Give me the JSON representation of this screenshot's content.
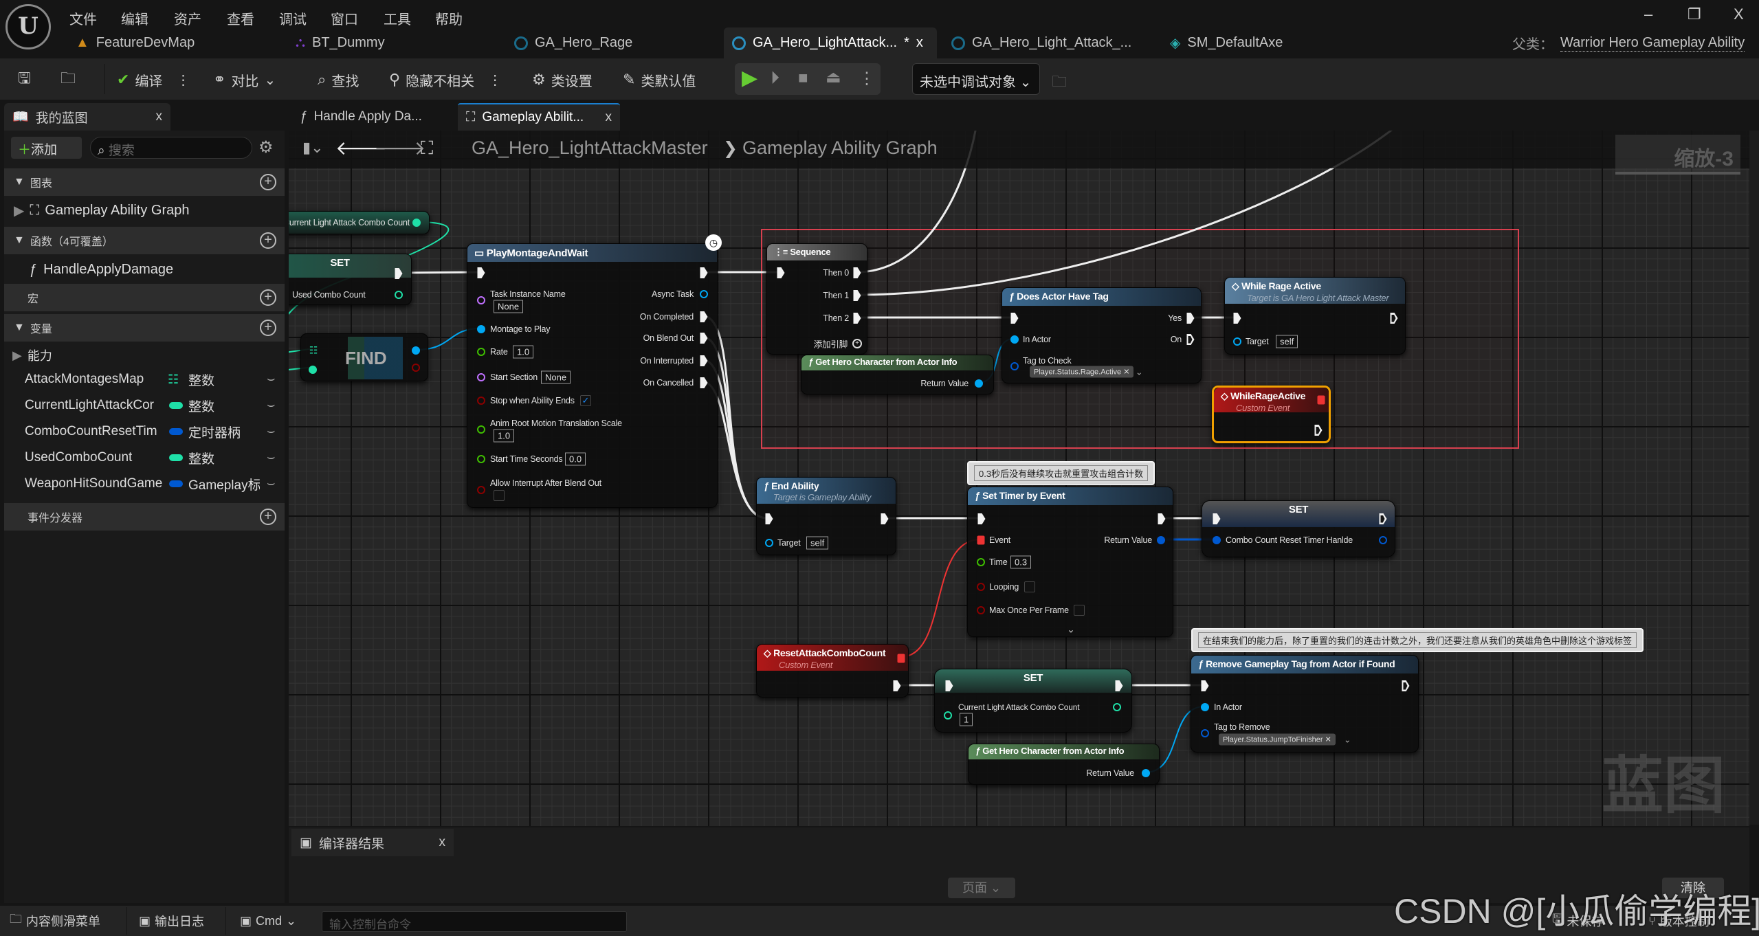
{
  "menu": [
    "文件",
    "编辑",
    "资产",
    "查看",
    "调试",
    "窗口",
    "工具",
    "帮助"
  ],
  "window_controls": {
    "minimize": "–",
    "restore": "❐",
    "close": "X"
  },
  "asset_tabs": [
    {
      "label": "FeatureDevMap",
      "icon": "level-icon"
    },
    {
      "label": "BT_Dummy",
      "icon": "behavior-tree-icon"
    },
    {
      "label": "GA_Hero_Rage",
      "icon": "blueprint-icon"
    },
    {
      "label": "GA_Hero_LightAttack...",
      "icon": "blueprint-icon",
      "active": true,
      "dirty": "*",
      "close": "x"
    },
    {
      "label": "GA_Hero_Light_Attack_...",
      "icon": "blueprint-icon"
    },
    {
      "label": "SM_DefaultAxe",
      "icon": "static-mesh-icon"
    }
  ],
  "parent_class": {
    "label": "父类：",
    "value": "Warrior Hero Gameplay Ability"
  },
  "toolbar": {
    "compile": "编译",
    "diff": "对比",
    "find": "查找",
    "hide_unrelated": "隐藏不相关",
    "class_settings": "类设置",
    "class_defaults": "类默认值",
    "debug_object": "未选中调试对象"
  },
  "my_blueprint": {
    "tab": "我的蓝图",
    "close": "x",
    "add": "添加",
    "search_placeholder": "搜索",
    "sections": {
      "graphs": "图表",
      "functions": "函数（4可覆盖）",
      "macros": "宏",
      "variables": "变量",
      "dispatchers": "事件分发器"
    },
    "graph_item": "Gameplay Ability Graph",
    "function_item": "HandleApplyDamage",
    "category": "能力",
    "variables": [
      {
        "name": "AttackMontagesMap",
        "type": "整数",
        "color": "#1fe0a8"
      },
      {
        "name": "CurrentLightAttackCor",
        "type": "整数",
        "color": "#1fe0a8"
      },
      {
        "name": "ComboCountResetTim",
        "type": "定时器柄",
        "color": "#0059d1"
      },
      {
        "name": "UsedComboCount",
        "type": "整数",
        "color": "#1fe0a8"
      },
      {
        "name": "WeaponHitSoundGame",
        "type": "Gameplay标",
        "color": "#0059d1"
      }
    ]
  },
  "graph_tabs": [
    {
      "label": "Handle Apply Da..."
    },
    {
      "label": "Gameplay Abilit...",
      "active": true,
      "close": "x"
    }
  ],
  "breadcrumb": {
    "blueprint": "GA_Hero_LightAttackMaster",
    "separator": "❯",
    "graph": "Gameplay Ability Graph"
  },
  "zoom_label": "缩放-3",
  "watermark": "蓝图",
  "nodes": {
    "getter": {
      "label": "Current Light Attack Combo Count"
    },
    "set_used": {
      "title": "SET",
      "pin": "Used Combo Count"
    },
    "find": {
      "title": "FIND"
    },
    "play_montage": {
      "title": "PlayMontageAndWait",
      "task_instance_name": "Task Instance Name",
      "task_instance_value": "None",
      "montage": "Montage to Play",
      "rate": "Rate",
      "rate_value": "1.0",
      "start_section": "Start Section",
      "start_section_value": "None",
      "stop_when_ends": "Stop when Ability Ends",
      "stop_when_ends_checked": true,
      "anim_root": "Anim Root Motion Translation Scale",
      "anim_root_value": "1.0",
      "start_time": "Start Time Seconds",
      "start_time_value": "0.0",
      "allow_interrupt": "Allow Interrupt After Blend Out",
      "allow_interrupt_checked": false,
      "async_task": "Async Task",
      "on_completed": "On Completed",
      "on_blend_out": "On Blend Out",
      "on_interrupted": "On Interrupted",
      "on_cancelled": "On Cancelled"
    },
    "sequence": {
      "title": "Sequence",
      "then0": "Then 0",
      "then1": "Then 1",
      "then2": "Then 2",
      "add_pin": "添加引脚"
    },
    "get_hero_1": {
      "title": "Get Hero Character from Actor Info",
      "return": "Return Value"
    },
    "does_actor_have_tag": {
      "title": "Does Actor Have Tag",
      "in_actor": "In Actor",
      "tag_to_check": "Tag to Check",
      "tag": "Player.Status.Rage.Active",
      "yes": "Yes",
      "no": "On"
    },
    "while_rage_active": {
      "title": "While Rage Active",
      "subtitle": "Target is GA Hero Light Attack Master",
      "target": "Target",
      "target_value": "self"
    },
    "while_rage_event": {
      "title": "WhileRageActive",
      "subtitle": "Custom Event"
    },
    "end_ability": {
      "title": "End Ability",
      "subtitle": "Target is Gameplay Ability",
      "target": "Target",
      "target_value": "self"
    },
    "set_timer": {
      "title": "Set Timer by Event",
      "event": "Event",
      "time": "Time",
      "time_value": "0.3",
      "looping": "Looping",
      "max_once": "Max Once Per Frame",
      "return": "Return Value"
    },
    "set_timer_handle": {
      "title": "SET",
      "pin": "Combo Count Reset Timer Hanlde"
    },
    "reset_event": {
      "title": "ResetAttackComboCount",
      "subtitle": "Custom Event"
    },
    "set_combo": {
      "title": "SET",
      "pin": "Current Light Attack Combo Count",
      "value": "1"
    },
    "remove_tag": {
      "title": "Remove Gameplay Tag from Actor if Found",
      "in_actor": "In Actor",
      "tag_to_remove": "Tag to Remove",
      "tag": "Player.Status.JumpToFinisher"
    },
    "get_hero_2": {
      "title": "Get Hero Character from Actor Info",
      "return": "Return Value"
    }
  },
  "comments": {
    "timer": "0.3秒后没有继续攻击就重置攻击组合计数",
    "remove": "在结束我们的能力后，除了重置的我们的连击计数之外，我们还要注意从我们的英雄角色中删除这个游戏标签"
  },
  "compiler": {
    "tab": "编译器结果",
    "close": "x",
    "page": "页面",
    "clear": "清除"
  },
  "status": {
    "content_drawer": "内容侧滑菜单",
    "output_log": "输出日志",
    "cmd": "Cmd",
    "console_placeholder": "输入控制台命令",
    "unsaved": "未保存",
    "source_control": "版本控制"
  },
  "csdn_watermark": "CSDN @[小瓜偷学编程]",
  "colors": {
    "exec": "#f2f2f2",
    "object": "#00a8f4",
    "integer": "#1fe0a8",
    "float": "#3fbf00",
    "name": "#c070ff",
    "bool": "#8b0000",
    "struct": "#0059d1",
    "delegate": "#e33333",
    "comment_box": "#d9404f",
    "selected": "#f0a000"
  }
}
